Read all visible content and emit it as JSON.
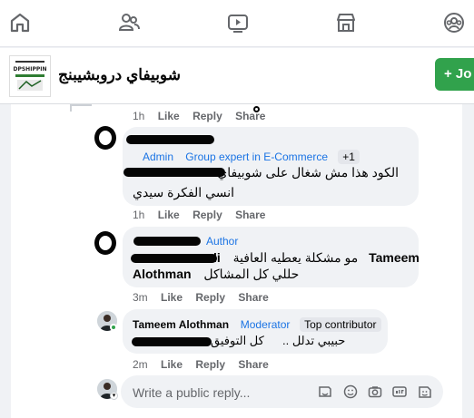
{
  "nav": {
    "icons": [
      "home-icon",
      "friends-icon",
      "video-icon",
      "marketplace-icon",
      "groups-icon"
    ]
  },
  "group": {
    "name": "شوبيفاي دروبشيبنج",
    "join_label": "+ Jo",
    "logo_text": "DPSHIPPIN"
  },
  "comments": [
    {
      "time": "1h",
      "actions": [
        "Like",
        "Reply",
        "Share"
      ]
    },
    {
      "badges": [
        "Admin",
        "Group expert in E-Commerce"
      ],
      "extra_badge": "+1",
      "lines": [
        "الكود هذا مش شغال على شوبيفاي",
        "انسي الفكرة سيدي"
      ],
      "time": "1h",
      "actions": [
        "Like",
        "Reply",
        "Share"
      ]
    },
    {
      "author_badge": "Author",
      "line1_mention": "Tameem",
      "line1_text": "مو مشكلة يعطيه العافية",
      "line1_partial": "li",
      "line2_mention": "Alothman",
      "line2_text": "حللي كل المشاكل",
      "time": "3m",
      "actions": [
        "Like",
        "Reply",
        "Share"
      ]
    },
    {
      "name": "Tameem Alothman",
      "role": "Moderator",
      "chip": "Top contributor",
      "line1": "كل التوفيق",
      "line2": "حبيبي تدلل ..",
      "time": "2m",
      "actions": [
        "Like",
        "Reply",
        "Share"
      ]
    }
  ],
  "reply_box": {
    "placeholder": "Write a public reply...",
    "tools": [
      "sticker-icon",
      "emoji-icon",
      "camera-icon",
      "gif-icon",
      "avatar-sticker-icon"
    ]
  },
  "colors": {
    "accent_blue": "#1b74e4",
    "join_green": "#31a24c",
    "muted": "#65676b"
  }
}
